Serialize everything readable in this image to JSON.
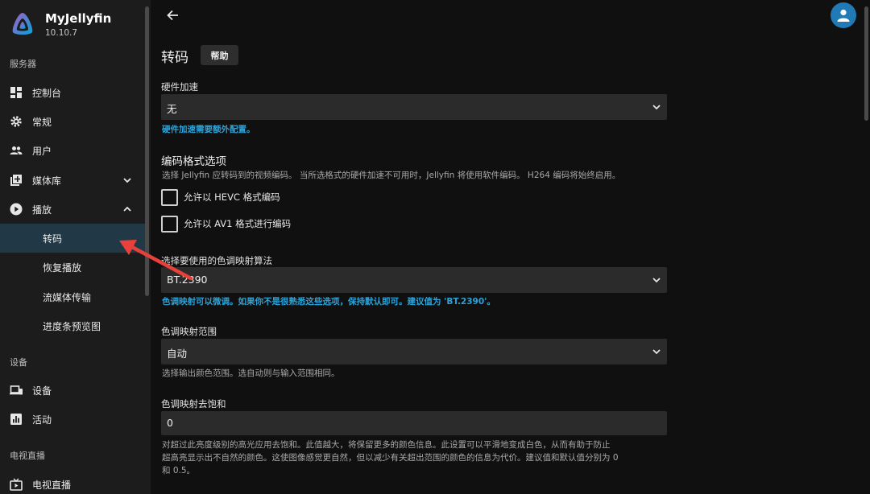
{
  "app": {
    "name": "MyJellyfin",
    "version": "10.10.7"
  },
  "sidebar": {
    "sections": [
      {
        "title": "服务器"
      },
      {
        "title": "设备"
      },
      {
        "title": "电视直播"
      }
    ],
    "items": [
      {
        "label": "控制台",
        "icon": "dashboard-icon"
      },
      {
        "label": "常规",
        "icon": "gear-icon"
      },
      {
        "label": "用户",
        "icon": "people-icon"
      },
      {
        "label": "媒体库",
        "icon": "library-add-icon"
      },
      {
        "label": "播放",
        "icon": "play-circle-icon"
      },
      {
        "label": "设备",
        "icon": "devices-icon"
      },
      {
        "label": "活动",
        "icon": "analytics-icon"
      },
      {
        "label": "电视直播",
        "icon": "live-tv-icon"
      }
    ],
    "playback_sub": [
      {
        "label": "转码",
        "active": true
      },
      {
        "label": "恢复播放"
      },
      {
        "label": "流媒体传输"
      },
      {
        "label": "进度条预览图"
      }
    ]
  },
  "main": {
    "title": "转码",
    "help_label": "帮助",
    "hw_accel": {
      "label": "硬件加速",
      "value": "无",
      "note": "硬件加速需要额外配置。"
    },
    "encoding": {
      "title": "编码格式选项",
      "description": "选择 Jellyfin 应转码到的视频编码。 当所选格式的硬件加速不可用时，Jellyfin 将使用软件编码。 H264 编码将始终启用。",
      "hevc_label": "允许以 HEVC 格式编码",
      "av1_label": "允许以 AV1 格式进行编码"
    },
    "tonemap_algo": {
      "label": "选择要使用的色调映射算法",
      "value": "BT.2390",
      "note": "色调映射可以微调。如果你不是很熟悉这些选项，保持默认即可。建议值为 'BT.2390'。"
    },
    "tonemap_range": {
      "label": "色调映射范围",
      "value": "自动",
      "note": "选择输出颜色范围。选自动则与输入范围相同。"
    },
    "tonemap_desat": {
      "label": "色调映射去饱和",
      "value": "0",
      "note_line1": "对超过此亮度级别的高光应用去饱和。此值越大，将保留更多的颜色信息。此设置可以平滑地变成白色，从而有助于防止",
      "note_line2": "超高亮显示出不自然的颜色。这使图像感觉更自然，但以减少有关超出范围的颜色的信息为代价。建议值和默认值分别为 0",
      "note_line3": "和 0.5。"
    }
  },
  "colors": {
    "accent": "#2ba3d9",
    "active_bg": "#213947",
    "arrow": "#e8403a"
  }
}
